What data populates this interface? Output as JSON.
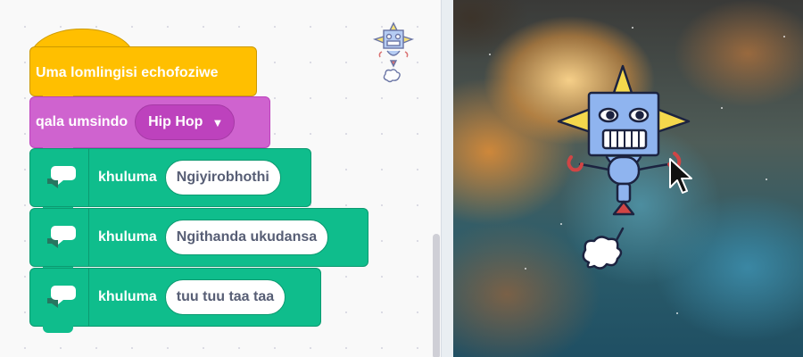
{
  "script": {
    "hat_block": {
      "label": "Uma lomlingisi echofoziwe"
    },
    "sound_block": {
      "label": "qala umsindo",
      "dropdown_value": "Hip Hop"
    },
    "say_blocks": [
      {
        "label": "khuluma",
        "value": "Ngiyirobhothi"
      },
      {
        "label": "khuluma",
        "value": "Ngithanda ukudansa"
      },
      {
        "label": "khuluma",
        "value": "tuu tuu taa taa"
      }
    ]
  },
  "colors": {
    "events": "#ffbf00",
    "sound": "#cf63cf",
    "text_to_speech": "#0fbd8c",
    "robot_body": "#8fb4ef"
  },
  "icons": {
    "sprite_thumbnail": "robot-sprite-icon",
    "say_extension": "speaker-speech-bubble-icon",
    "dropdown": "caret-down-icon",
    "stage_sprite": "robot-sprite",
    "cursor": "mouse-pointer-icon"
  }
}
